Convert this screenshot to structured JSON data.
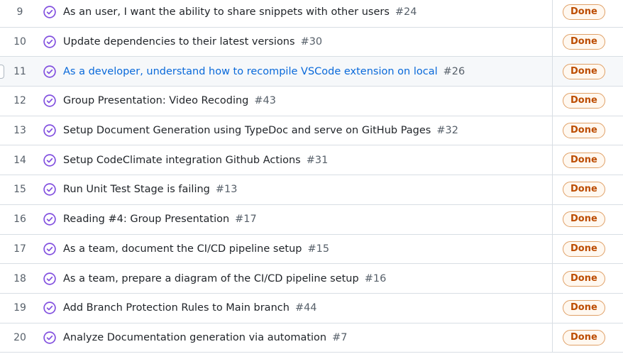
{
  "colors": {
    "accent_purple": "#8250df",
    "link_blue": "#0969da",
    "status_orange": "#bc4c00"
  },
  "rows": [
    {
      "num": "9",
      "title": "As an user, I want the ability to share snippets with other users",
      "issue": "#24",
      "status": "Done",
      "icon": "completed-circle-check-icon"
    },
    {
      "num": "10",
      "title": "Update dependencies to their latest versions",
      "issue": "#30",
      "status": "Done",
      "icon": "completed-circle-check-icon"
    },
    {
      "num": "11",
      "title": "As a developer, understand how to recompile VSCode extension on local",
      "issue": "#26",
      "status": "Done",
      "icon": "completed-circle-check-icon"
    },
    {
      "num": "12",
      "title": "Group Presentation: Video Recoding",
      "issue": "#43",
      "status": "Done",
      "icon": "completed-circle-check-icon"
    },
    {
      "num": "13",
      "title": "Setup Document Generation using TypeDoc and serve on GitHub Pages",
      "issue": "#32",
      "status": "Done",
      "icon": "completed-circle-check-icon"
    },
    {
      "num": "14",
      "title": "Setup CodeClimate integration Github Actions",
      "issue": "#31",
      "status": "Done",
      "icon": "completed-circle-check-icon"
    },
    {
      "num": "15",
      "title": "Run Unit Test Stage is failing",
      "issue": "#13",
      "status": "Done",
      "icon": "completed-circle-check-icon"
    },
    {
      "num": "16",
      "title": "Reading #4: Group Presentation",
      "issue": "#17",
      "status": "Done",
      "icon": "completed-circle-check-icon"
    },
    {
      "num": "17",
      "title": "As a team, document the CI/CD pipeline setup",
      "issue": "#15",
      "status": "Done",
      "icon": "completed-circle-check-icon"
    },
    {
      "num": "18",
      "title": "As a team, prepare a diagram of the CI/CD pipeline setup",
      "issue": "#16",
      "status": "Done",
      "icon": "completed-circle-check-icon"
    },
    {
      "num": "19",
      "title": "Add Branch Protection Rules to Main branch",
      "issue": "#44",
      "status": "Done",
      "icon": "completed-circle-check-icon"
    },
    {
      "num": "20",
      "title": "Analyze Documentation generation via automation",
      "issue": "#7",
      "status": "Done",
      "icon": "completed-circle-check-icon"
    }
  ]
}
